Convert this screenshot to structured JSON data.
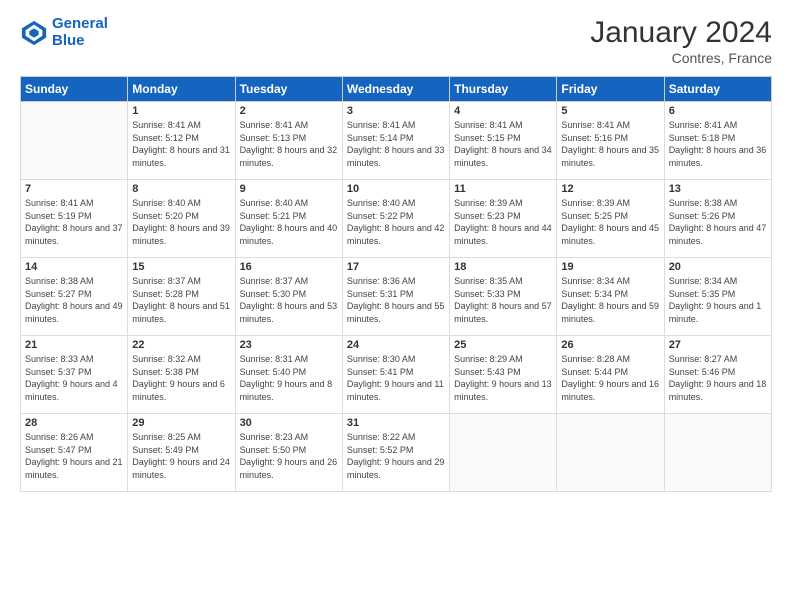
{
  "header": {
    "logo_line1": "General",
    "logo_line2": "Blue",
    "title": "January 2024",
    "location": "Contres, France"
  },
  "days_of_week": [
    "Sunday",
    "Monday",
    "Tuesday",
    "Wednesday",
    "Thursday",
    "Friday",
    "Saturday"
  ],
  "weeks": [
    [
      {
        "day": "",
        "sunrise": "",
        "sunset": "",
        "daylight": ""
      },
      {
        "day": "1",
        "sunrise": "Sunrise: 8:41 AM",
        "sunset": "Sunset: 5:12 PM",
        "daylight": "Daylight: 8 hours and 31 minutes."
      },
      {
        "day": "2",
        "sunrise": "Sunrise: 8:41 AM",
        "sunset": "Sunset: 5:13 PM",
        "daylight": "Daylight: 8 hours and 32 minutes."
      },
      {
        "day": "3",
        "sunrise": "Sunrise: 8:41 AM",
        "sunset": "Sunset: 5:14 PM",
        "daylight": "Daylight: 8 hours and 33 minutes."
      },
      {
        "day": "4",
        "sunrise": "Sunrise: 8:41 AM",
        "sunset": "Sunset: 5:15 PM",
        "daylight": "Daylight: 8 hours and 34 minutes."
      },
      {
        "day": "5",
        "sunrise": "Sunrise: 8:41 AM",
        "sunset": "Sunset: 5:16 PM",
        "daylight": "Daylight: 8 hours and 35 minutes."
      },
      {
        "day": "6",
        "sunrise": "Sunrise: 8:41 AM",
        "sunset": "Sunset: 5:18 PM",
        "daylight": "Daylight: 8 hours and 36 minutes."
      }
    ],
    [
      {
        "day": "7",
        "sunrise": "Sunrise: 8:41 AM",
        "sunset": "Sunset: 5:19 PM",
        "daylight": "Daylight: 8 hours and 37 minutes."
      },
      {
        "day": "8",
        "sunrise": "Sunrise: 8:40 AM",
        "sunset": "Sunset: 5:20 PM",
        "daylight": "Daylight: 8 hours and 39 minutes."
      },
      {
        "day": "9",
        "sunrise": "Sunrise: 8:40 AM",
        "sunset": "Sunset: 5:21 PM",
        "daylight": "Daylight: 8 hours and 40 minutes."
      },
      {
        "day": "10",
        "sunrise": "Sunrise: 8:40 AM",
        "sunset": "Sunset: 5:22 PM",
        "daylight": "Daylight: 8 hours and 42 minutes."
      },
      {
        "day": "11",
        "sunrise": "Sunrise: 8:39 AM",
        "sunset": "Sunset: 5:23 PM",
        "daylight": "Daylight: 8 hours and 44 minutes."
      },
      {
        "day": "12",
        "sunrise": "Sunrise: 8:39 AM",
        "sunset": "Sunset: 5:25 PM",
        "daylight": "Daylight: 8 hours and 45 minutes."
      },
      {
        "day": "13",
        "sunrise": "Sunrise: 8:38 AM",
        "sunset": "Sunset: 5:26 PM",
        "daylight": "Daylight: 8 hours and 47 minutes."
      }
    ],
    [
      {
        "day": "14",
        "sunrise": "Sunrise: 8:38 AM",
        "sunset": "Sunset: 5:27 PM",
        "daylight": "Daylight: 8 hours and 49 minutes."
      },
      {
        "day": "15",
        "sunrise": "Sunrise: 8:37 AM",
        "sunset": "Sunset: 5:28 PM",
        "daylight": "Daylight: 8 hours and 51 minutes."
      },
      {
        "day": "16",
        "sunrise": "Sunrise: 8:37 AM",
        "sunset": "Sunset: 5:30 PM",
        "daylight": "Daylight: 8 hours and 53 minutes."
      },
      {
        "day": "17",
        "sunrise": "Sunrise: 8:36 AM",
        "sunset": "Sunset: 5:31 PM",
        "daylight": "Daylight: 8 hours and 55 minutes."
      },
      {
        "day": "18",
        "sunrise": "Sunrise: 8:35 AM",
        "sunset": "Sunset: 5:33 PM",
        "daylight": "Daylight: 8 hours and 57 minutes."
      },
      {
        "day": "19",
        "sunrise": "Sunrise: 8:34 AM",
        "sunset": "Sunset: 5:34 PM",
        "daylight": "Daylight: 8 hours and 59 minutes."
      },
      {
        "day": "20",
        "sunrise": "Sunrise: 8:34 AM",
        "sunset": "Sunset: 5:35 PM",
        "daylight": "Daylight: 9 hours and 1 minute."
      }
    ],
    [
      {
        "day": "21",
        "sunrise": "Sunrise: 8:33 AM",
        "sunset": "Sunset: 5:37 PM",
        "daylight": "Daylight: 9 hours and 4 minutes."
      },
      {
        "day": "22",
        "sunrise": "Sunrise: 8:32 AM",
        "sunset": "Sunset: 5:38 PM",
        "daylight": "Daylight: 9 hours and 6 minutes."
      },
      {
        "day": "23",
        "sunrise": "Sunrise: 8:31 AM",
        "sunset": "Sunset: 5:40 PM",
        "daylight": "Daylight: 9 hours and 8 minutes."
      },
      {
        "day": "24",
        "sunrise": "Sunrise: 8:30 AM",
        "sunset": "Sunset: 5:41 PM",
        "daylight": "Daylight: 9 hours and 11 minutes."
      },
      {
        "day": "25",
        "sunrise": "Sunrise: 8:29 AM",
        "sunset": "Sunset: 5:43 PM",
        "daylight": "Daylight: 9 hours and 13 minutes."
      },
      {
        "day": "26",
        "sunrise": "Sunrise: 8:28 AM",
        "sunset": "Sunset: 5:44 PM",
        "daylight": "Daylight: 9 hours and 16 minutes."
      },
      {
        "day": "27",
        "sunrise": "Sunrise: 8:27 AM",
        "sunset": "Sunset: 5:46 PM",
        "daylight": "Daylight: 9 hours and 18 minutes."
      }
    ],
    [
      {
        "day": "28",
        "sunrise": "Sunrise: 8:26 AM",
        "sunset": "Sunset: 5:47 PM",
        "daylight": "Daylight: 9 hours and 21 minutes."
      },
      {
        "day": "29",
        "sunrise": "Sunrise: 8:25 AM",
        "sunset": "Sunset: 5:49 PM",
        "daylight": "Daylight: 9 hours and 24 minutes."
      },
      {
        "day": "30",
        "sunrise": "Sunrise: 8:23 AM",
        "sunset": "Sunset: 5:50 PM",
        "daylight": "Daylight: 9 hours and 26 minutes."
      },
      {
        "day": "31",
        "sunrise": "Sunrise: 8:22 AM",
        "sunset": "Sunset: 5:52 PM",
        "daylight": "Daylight: 9 hours and 29 minutes."
      },
      {
        "day": "",
        "sunrise": "",
        "sunset": "",
        "daylight": ""
      },
      {
        "day": "",
        "sunrise": "",
        "sunset": "",
        "daylight": ""
      },
      {
        "day": "",
        "sunrise": "",
        "sunset": "",
        "daylight": ""
      }
    ]
  ]
}
